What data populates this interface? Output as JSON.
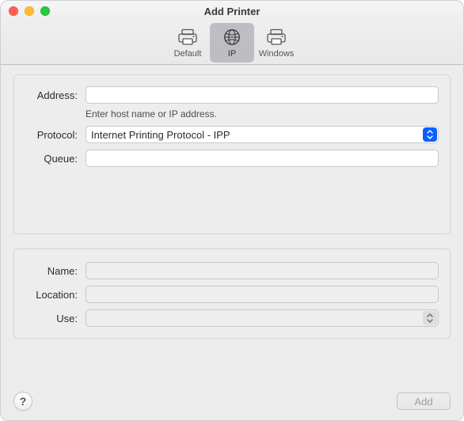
{
  "window": {
    "title": "Add Printer"
  },
  "toolbar": {
    "items": [
      {
        "label": "Default",
        "icon": "printer-icon"
      },
      {
        "label": "IP",
        "icon": "globe-icon"
      },
      {
        "label": "Windows",
        "icon": "printer-icon"
      }
    ],
    "selected_index": 1
  },
  "form_top": {
    "address": {
      "label": "Address:",
      "value": "",
      "hint": "Enter host name or IP address."
    },
    "protocol": {
      "label": "Protocol:",
      "value": "Internet Printing Protocol - IPP"
    },
    "queue": {
      "label": "Queue:",
      "value": ""
    }
  },
  "form_bottom": {
    "name": {
      "label": "Name:",
      "value": ""
    },
    "location": {
      "label": "Location:",
      "value": ""
    },
    "use": {
      "label": "Use:",
      "value": ""
    }
  },
  "footer": {
    "help_glyph": "?",
    "add_label": "Add"
  }
}
